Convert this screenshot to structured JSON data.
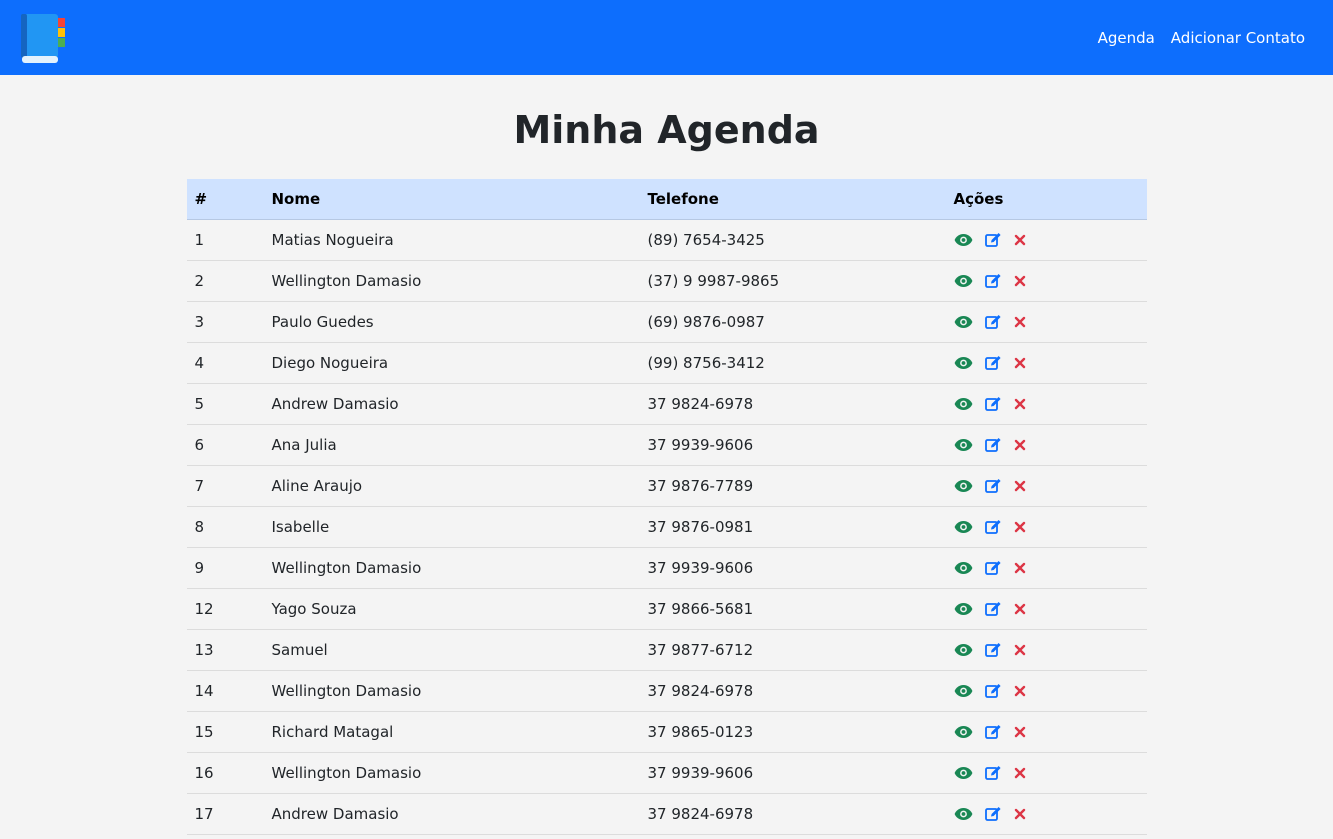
{
  "nav": {
    "links": [
      "Agenda",
      "Adicionar Contato"
    ]
  },
  "title": "Minha Agenda",
  "table": {
    "headers": [
      "#",
      "Nome",
      "Telefone",
      "Ações"
    ],
    "rows": [
      {
        "id": "1",
        "name": "Matias Nogueira",
        "phone": "(89) 7654-3425"
      },
      {
        "id": "2",
        "name": "Wellington Damasio",
        "phone": "(37) 9 9987-9865"
      },
      {
        "id": "3",
        "name": "Paulo Guedes",
        "phone": "(69) 9876-0987"
      },
      {
        "id": "4",
        "name": "Diego Nogueira",
        "phone": "(99) 8756-3412"
      },
      {
        "id": "5",
        "name": "Andrew Damasio",
        "phone": "37 9824-6978"
      },
      {
        "id": "6",
        "name": "Ana Julia",
        "phone": "37 9939-9606"
      },
      {
        "id": "7",
        "name": "Aline Araujo",
        "phone": "37 9876-7789"
      },
      {
        "id": "8",
        "name": "Isabelle",
        "phone": "37 9876-0981"
      },
      {
        "id": "9",
        "name": "Wellington Damasio",
        "phone": "37 9939-9606"
      },
      {
        "id": "12",
        "name": "Yago Souza",
        "phone": "37 9866-5681"
      },
      {
        "id": "13",
        "name": "Samuel",
        "phone": "37 9877-6712"
      },
      {
        "id": "14",
        "name": "Wellington Damasio",
        "phone": "37 9824-6978"
      },
      {
        "id": "15",
        "name": "Richard Matagal",
        "phone": "37 9865-0123"
      },
      {
        "id": "16",
        "name": "Wellington Damasio",
        "phone": "37 9939-9606"
      },
      {
        "id": "17",
        "name": "Andrew Damasio",
        "phone": "37 9824-6978"
      }
    ]
  },
  "icons": {
    "view": "eye-icon",
    "edit": "edit-icon",
    "delete": "close-icon"
  },
  "colors": {
    "navbar": "#0d6efd",
    "header_row": "#cfe2ff",
    "view": "#198754",
    "edit": "#0d6efd",
    "delete": "#dc3545"
  }
}
